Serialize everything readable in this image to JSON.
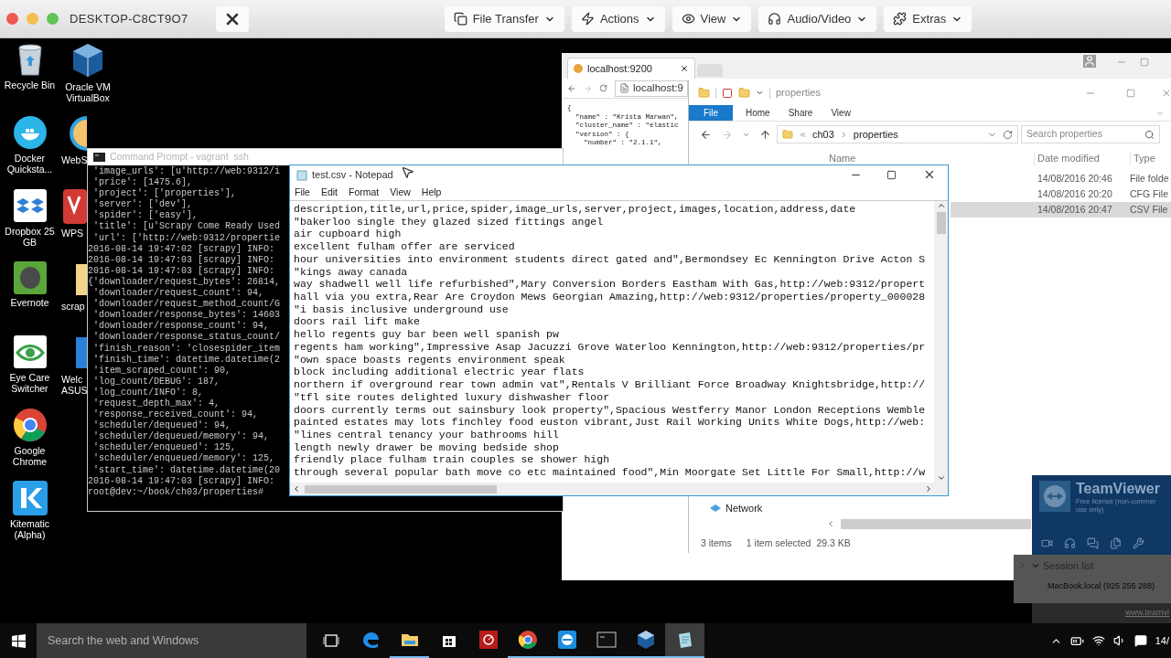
{
  "remote_toolbar": {
    "computer_name": "DESKTOP-C8CT9O7",
    "menus": [
      {
        "label": "File Transfer"
      },
      {
        "label": "Actions"
      },
      {
        "label": "View"
      },
      {
        "label": "Audio/Video"
      },
      {
        "label": "Extras"
      }
    ]
  },
  "desktop": {
    "columns": [
      [
        {
          "label": "Recycle Bin"
        },
        {
          "label": "Docker Quicksta..."
        },
        {
          "label": "Dropbox 25 GB"
        },
        {
          "label": "Evernote"
        },
        {
          "label": "Eye Care Switcher"
        },
        {
          "label": "Google Chrome"
        },
        {
          "label": "Kitematic (Alpha)"
        }
      ],
      [
        {
          "label": "Oracle VM VirtualBox"
        },
        {
          "label": "WebS"
        },
        {
          "label": "WPS"
        },
        {
          "label": "scrap"
        },
        {
          "label": "Welc ASUS"
        }
      ]
    ]
  },
  "browser": {
    "tab": "localhost:9200",
    "address": "localhost:9",
    "body_lines": [
      "{",
      "  \"name\" : \"Krista Marwan\",",
      "  \"cluster_name\" : \"elastic",
      "  \"version\" : {",
      "    \"number\" : \"2.1.1\","
    ]
  },
  "explorer": {
    "title": "properties",
    "ribbon_tabs": [
      {
        "label": "File",
        "kind": "menu"
      },
      {
        "label": "Home",
        "kind": "tab"
      },
      {
        "label": "Share",
        "kind": "tab"
      },
      {
        "label": "View",
        "kind": "tab"
      }
    ],
    "path": [
      "ch03",
      "properties"
    ],
    "search": {
      "placeholder": "Search properties"
    },
    "columns": [
      "Name",
      "Date modified",
      "Type"
    ],
    "rows": [
      {
        "date_modified": "14/08/2016 20:46",
        "type": "File folde",
        "selected": false
      },
      {
        "date_modified": "14/08/2016 20:20",
        "type": "CFG File",
        "selected": false
      },
      {
        "date_modified": "14/08/2016 20:47",
        "type": "CSV File",
        "selected": true
      }
    ],
    "nav_items": [
      {
        "label": "Network"
      }
    ],
    "status": {
      "item_count": "3 items",
      "selection": "1 item selected",
      "size": "29.3 KB"
    }
  },
  "command_prompt": {
    "title": "Command Prompt - vagrant  ssh",
    "lines": [
      " 'image_urls': [u'http://web:9312/i",
      " 'price': [1475.6],",
      " 'project': ['properties'],",
      " 'server': ['dev'],",
      " 'spider': ['easy'],",
      " 'title': [u'Scrapy Come Ready Used",
      " 'url': ['http://web:9312/propertie",
      "2016-08-14 19:47:02 [scrapy] INFO:",
      "2016-08-14 19:47:03 [scrapy] INFO:",
      "2016-08-14 19:47:03 [scrapy] INFO:",
      "{'downloader/request_bytes': 26814,",
      " 'downloader/request_count': 94,",
      " 'downloader/request_method_count/G",
      " 'downloader/response_bytes': 14603",
      " 'downloader/response_count': 94,",
      " 'downloader/response_status_count/",
      " 'finish_reason': 'closespider_item",
      " 'finish_time': datetime.datetime(2",
      " 'item_scraped_count': 90,",
      " 'log_count/DEBUG': 187,",
      " 'log_count/INFO': 8,",
      " 'request_depth_max': 4,",
      " 'response_received_count': 94,",
      " 'scheduler/dequeued': 94,",
      " 'scheduler/dequeued/memory': 94,",
      " 'scheduler/enqueued': 125,",
      " 'scheduler/enqueued/memory': 125,",
      " 'start_time': datetime.datetime(20",
      "2016-08-14 19:47:03 [scrapy] INFO:",
      "root@dev:~/book/ch03/properties#"
    ]
  },
  "notepad": {
    "title": "test.csv - Notepad",
    "menu": [
      "File",
      "Edit",
      "Format",
      "View",
      "Help"
    ],
    "lines": [
      "description,title,url,price,spider,image_urls,server,project,images,location,address,date",
      "\"bakerloo single they glazed sized fittings angel",
      "air cupboard high",
      "excellent fulham offer are serviced",
      "hour universities into environment students direct gated and\",Bermondsey Ec Kennington Drive Acton S",
      "\"kings away canada",
      "way shadwell well life refurbished\",Mary Conversion Borders Eastham With Gas,http://web:9312/propert",
      "hall via you extra,Rear Are Croydon Mews Georgian Amazing,http://web:9312/properties/property_000028",
      "\"i basis inclusive underground use",
      "doors rail lift make",
      "hello regents guy bar been well spanish pw",
      "regents ham working\",Impressive Asap Jacuzzi Grove Waterloo Kennington,http://web:9312/properties/pr",
      "\"own space boasts regents environment speak",
      "block including additional electric year flats",
      "northern if overground rear town admin vat\",Rentals V Brilliant Force Broadway Knightsbridge,http://",
      "\"tfl site routes delighted luxury dishwasher floor",
      "doors currently terms out sainsbury look property\",Spacious Westferry Manor London Receptions Wemble",
      "painted estates may lots finchley food euston vibrant,Just Rail Working Units White Dogs,http://web:",
      "\"lines central tenancy your bathrooms hill",
      "length newly drawer be moving bedside shop",
      "friendly place fulham train couples se shower high",
      "through several popular bath move co etc maintained food\",Min Moorgate Set Little For Small,http://w"
    ]
  },
  "teamviewer_panel": {
    "brand": "TeamViewer",
    "license": [
      "Free license (non-commer",
      "use only)"
    ],
    "session_list": {
      "title": "Session list",
      "sessions": [
        "MacBook.local (925 256 288)"
      ]
    },
    "link": "www.teamvi"
  },
  "taskbar": {
    "search": {
      "placeholder": "Search the web and Windows"
    },
    "apps": [
      {
        "running": false,
        "selected": false
      },
      {
        "running": true,
        "selected": false
      },
      {
        "running": false,
        "selected": false
      },
      {
        "running": false,
        "selected": false
      },
      {
        "running": true,
        "selected": false
      },
      {
        "running": true,
        "selected": false
      },
      {
        "running": true,
        "selected": false
      },
      {
        "running": true,
        "selected": false
      },
      {
        "running": true,
        "selected": true
      }
    ],
    "clock": "14/"
  }
}
